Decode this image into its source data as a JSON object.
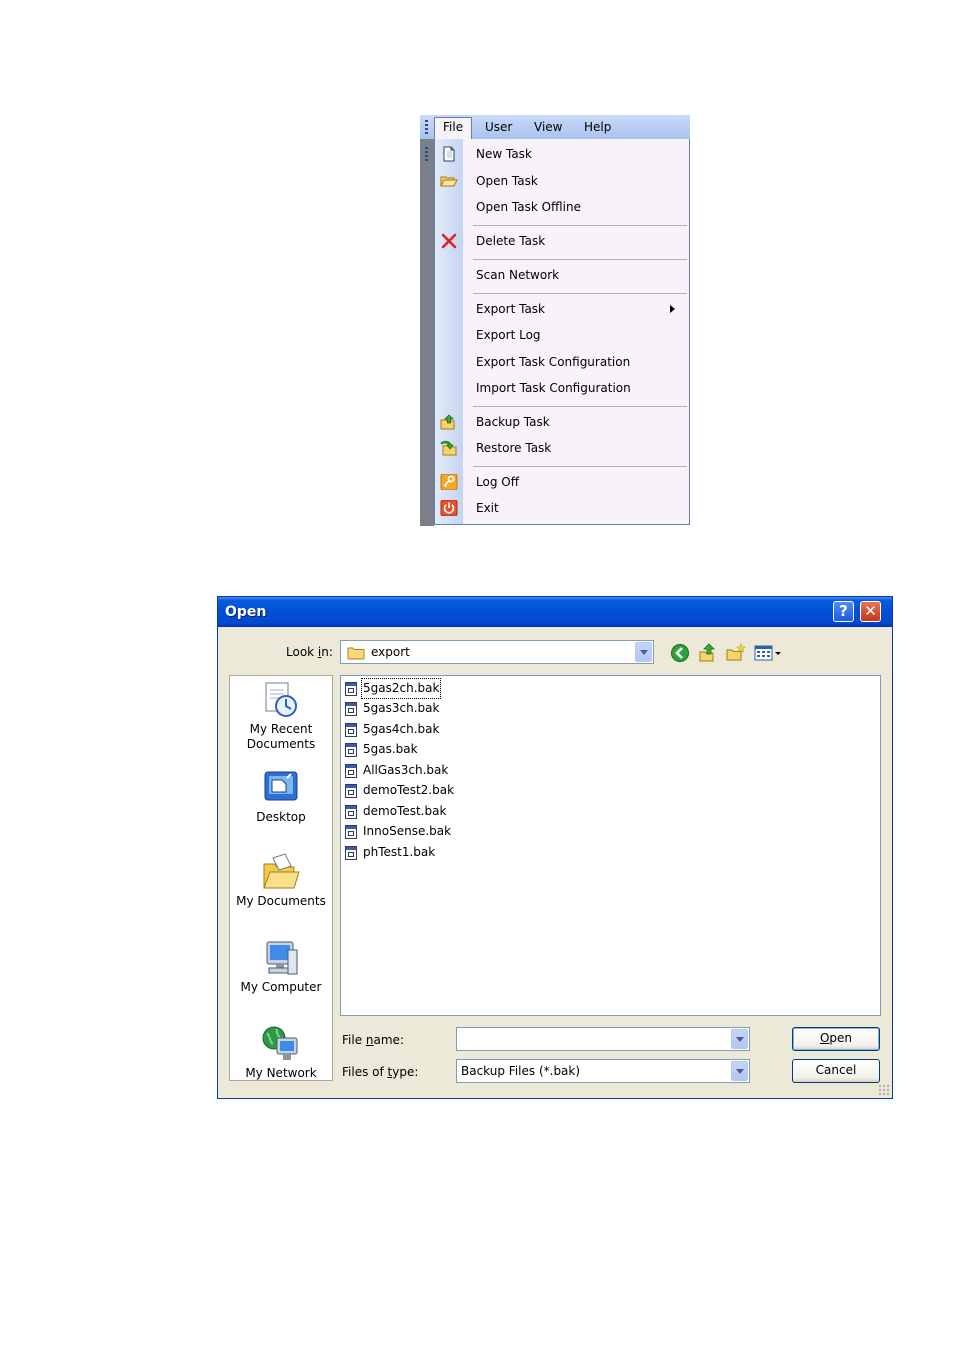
{
  "menu": {
    "bar": [
      "File",
      "User",
      "View",
      "Help"
    ],
    "active": "File",
    "items": [
      {
        "label": "New Task",
        "icon": "new-document-icon"
      },
      {
        "label": "Open Task",
        "icon": "folder-open-icon"
      },
      {
        "label": "Open Task Offline",
        "icon": ""
      },
      {
        "label": "Delete Task",
        "icon": "red-x-icon"
      },
      {
        "label": "Scan Network",
        "icon": ""
      },
      {
        "label": "Export Task",
        "icon": "",
        "submenu": true
      },
      {
        "label": "Export Log",
        "icon": ""
      },
      {
        "label": "Export Task Configuration",
        "icon": ""
      },
      {
        "label": "Import Task Configuration",
        "icon": ""
      },
      {
        "label": "Backup Task",
        "icon": "backup-icon"
      },
      {
        "label": "Restore Task",
        "icon": "restore-icon"
      },
      {
        "label": "Log Off",
        "icon": "key-icon"
      },
      {
        "label": "Exit",
        "icon": "power-icon"
      }
    ]
  },
  "dialog": {
    "title": "Open",
    "help_button": "?",
    "close_button": "✕",
    "look_in_label": "Look in:",
    "look_in_value": "export",
    "places": [
      "My Recent Documents",
      "Desktop",
      "My Documents",
      "My Computer",
      "My Network"
    ],
    "files": [
      "5gas2ch.bak",
      "5gas3ch.bak",
      "5gas4ch.bak",
      "5gas.bak",
      "AllGas3ch.bak",
      "demoTest2.bak",
      "demoTest.bak",
      "InnoSense.bak",
      "phTest1.bak"
    ],
    "file_name_label": "File name:",
    "file_name_value": "",
    "files_of_type_label": "Files of type:",
    "files_of_type_value": "Backup  Files (*.bak)",
    "open_button": "Open",
    "cancel_button": "Cancel"
  },
  "colors": {
    "title_bar": "#0050d8",
    "dialog_bg": "#ece9d8",
    "menu_bg": "#f8f3f8",
    "menu_icon_column": "#c3d4f1"
  }
}
